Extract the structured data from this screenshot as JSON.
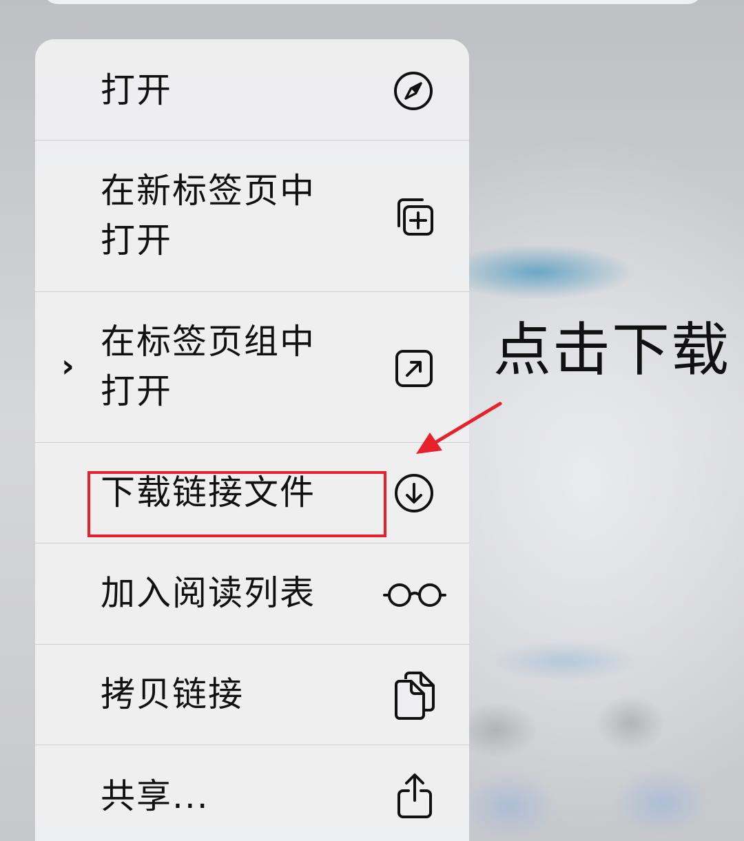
{
  "menu": {
    "items": [
      {
        "label": "打开",
        "icon": "compass-icon"
      },
      {
        "label": "在新标签页中\n打开",
        "icon": "plus-square-on-square-icon"
      },
      {
        "label": "在标签页组中\n打开",
        "icon": "arrow-up-right-square-icon",
        "has_submenu": true
      },
      {
        "label": "下载链接文件",
        "icon": "arrow-down-circle-icon"
      },
      {
        "label": "加入阅读列表",
        "icon": "eyeglasses-icon"
      },
      {
        "label": "拷贝链接",
        "icon": "doc-on-doc-icon"
      },
      {
        "label": "共享...",
        "icon": "share-icon"
      }
    ]
  },
  "annotation": {
    "text": "点击下载",
    "color": "#e8202a"
  }
}
